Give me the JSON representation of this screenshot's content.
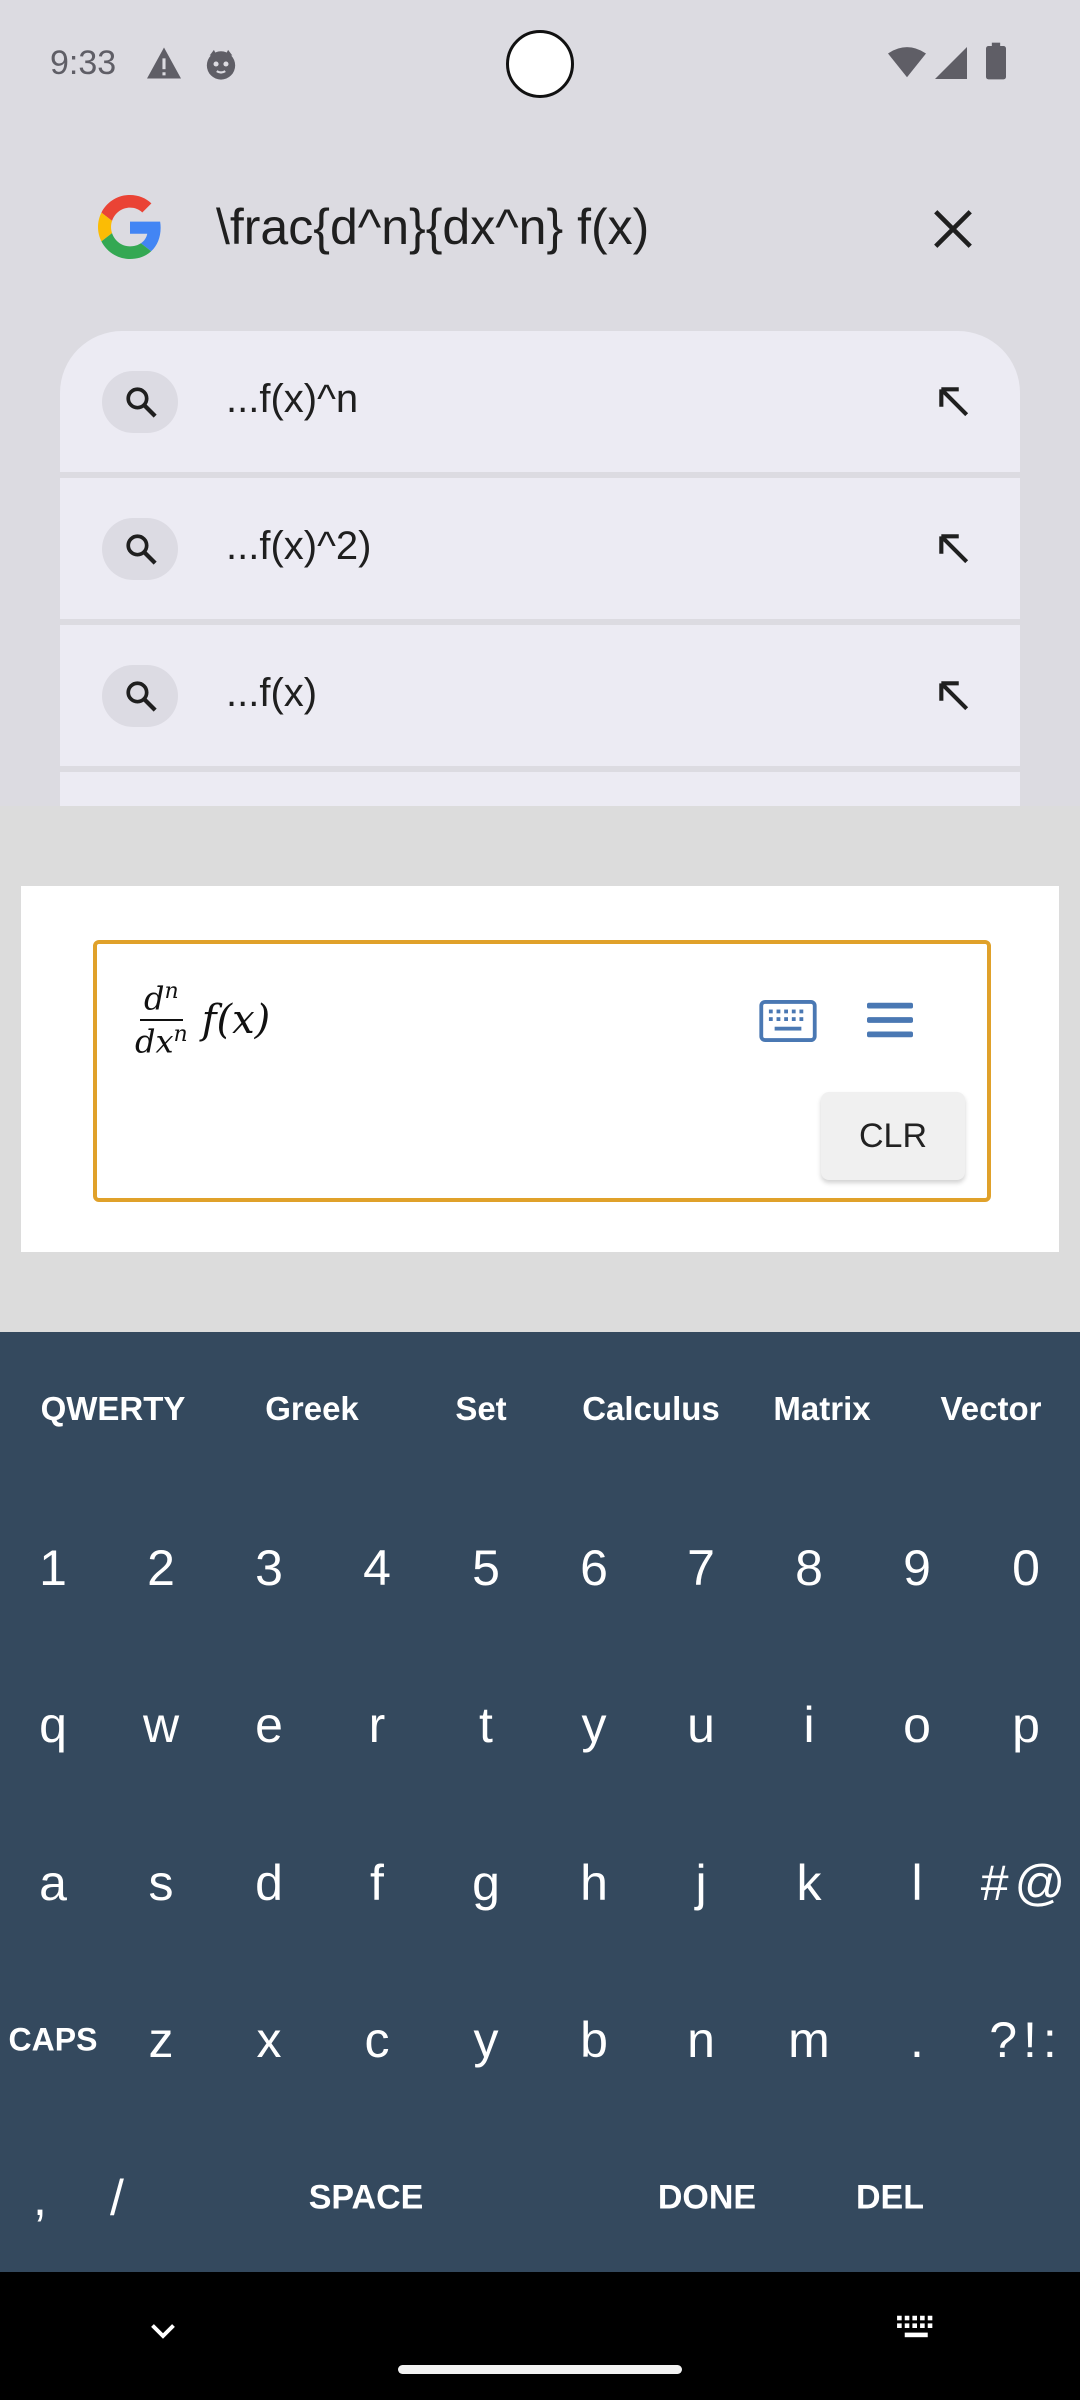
{
  "status_bar": {
    "time": "9:33"
  },
  "search": {
    "query": "\\frac{d^n}{dx^n} f(x)",
    "suggestions": [
      {
        "text": "...f(x)^n"
      },
      {
        "text": "...f(x)^2)"
      },
      {
        "text": "...f(x)"
      }
    ]
  },
  "math_editor": {
    "expression": {
      "numerator": "d",
      "numerator_sup": "n",
      "denominator": "dx",
      "denominator_sup": "n",
      "function": "f(x)"
    },
    "clear_label": "CLR",
    "border_color": "#e0a12a",
    "icon_color": "#4a78b3"
  },
  "keyboard": {
    "background": "#34495e",
    "tabs": [
      "QWERTY",
      "Greek",
      "Set",
      "Calculus",
      "Matrix",
      "Vector"
    ],
    "rows": [
      [
        "1",
        "2",
        "3",
        "4",
        "5",
        "6",
        "7",
        "8",
        "9",
        "0"
      ],
      [
        "q",
        "w",
        "e",
        "r",
        "t",
        "y",
        "u",
        "i",
        "o",
        "p"
      ],
      [
        "a",
        "s",
        "d",
        "f",
        "g",
        "h",
        "j",
        "k",
        "l",
        "#@"
      ],
      [
        "CAPS",
        "z",
        "x",
        "c",
        "y",
        "b",
        "n",
        "m",
        ".",
        "?!:"
      ]
    ],
    "bottom_row": [
      ",",
      "/",
      "SPACE",
      "DONE",
      "DEL"
    ]
  },
  "icons": {
    "warning": "warning-icon",
    "notification_app": "cat-face-icon",
    "wifi": "wifi-icon",
    "signal": "signal-icon",
    "battery": "battery-icon",
    "search": "search-icon",
    "fill_arrow": "arrow-up-left-icon",
    "close": "close-icon",
    "keyboard": "keyboard-icon",
    "menu": "hamburger-menu-icon",
    "nav_back": "chevron-down-icon"
  }
}
